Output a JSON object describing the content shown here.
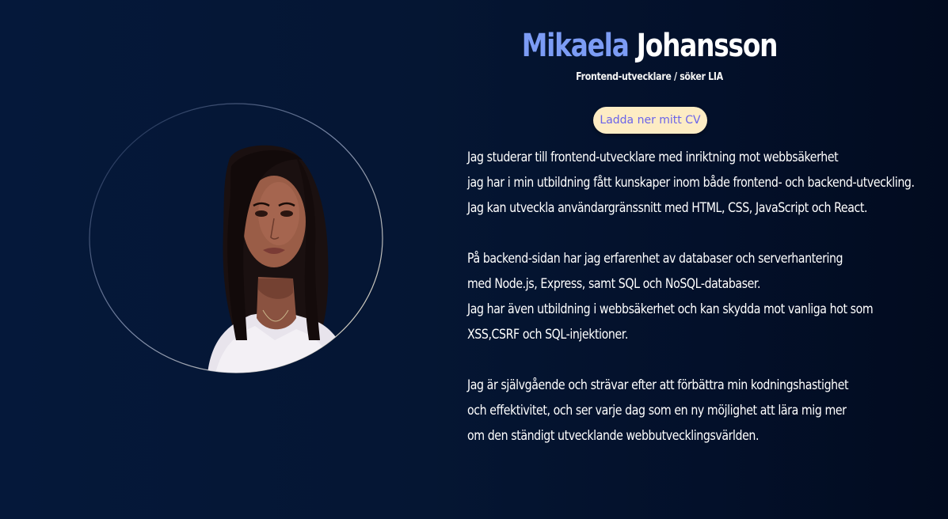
{
  "header": {
    "first_name": "Mikaela",
    "last_name": "Johansson",
    "subtitle": "Frontend-utvecklare / söker LIA"
  },
  "cv_button": {
    "label": "Ladda ner mitt CV"
  },
  "about": {
    "paragraphs": [
      {
        "lines": [
          "Jag studerar till frontend-utvecklare med inriktning mot webbsäkerhet",
          "jag har i min utbildning fått kunskaper inom både frontend- och backend-utveckling.",
          "Jag kan utveckla användargränssnitt med HTML, CSS, JavaScript och React."
        ]
      },
      {
        "lines": [
          "På backend-sidan har jag erfarenhet av databaser och serverhantering",
          "med Node.js, Express, samt SQL och NoSQL-databaser.",
          "Jag har även utbildning i webbsäkerhet och kan skydda mot vanliga hot som",
          "XSS,CSRF och SQL-injektioner."
        ]
      },
      {
        "lines": [
          "Jag är självgående och strävar efter att förbättra min kodningshastighet",
          "och effektivitet, och ser varje dag som en ny möjlighet att lära mig mer",
          "om den ständigt utvecklande webbutvecklingsvärlden."
        ]
      }
    ]
  },
  "colors": {
    "background": "#051633",
    "accent_name": "#7c9cf5",
    "button_bg": "#fdecc4",
    "button_text": "#6a63ea"
  },
  "icons": {
    "portrait": "profile-photo"
  }
}
